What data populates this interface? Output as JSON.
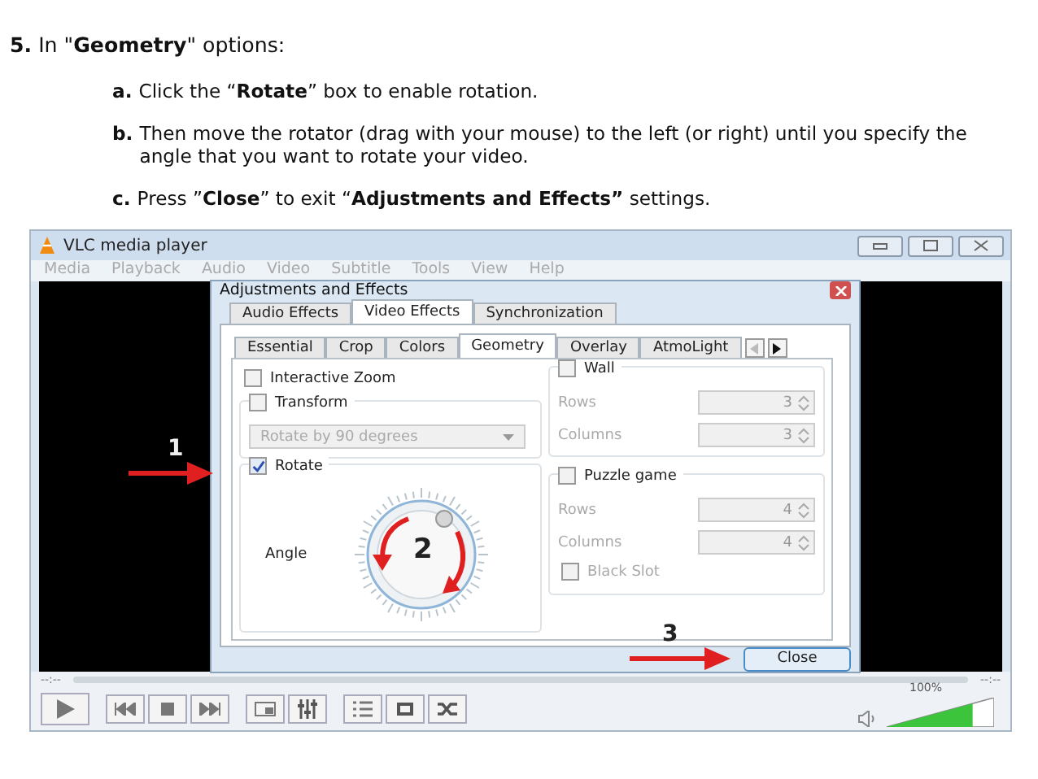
{
  "instructions": {
    "heading": {
      "marker": "5.",
      "text": "In \"**Geometry**\" options:"
    },
    "steps": [
      {
        "marker": "a.",
        "text": "Click the “**Rotate**” box to enable rotation."
      },
      {
        "marker": "b.",
        "text": "Then move the rotator (drag with your mouse) to the left (or right) until you specify the angle that you want to rotate your video."
      },
      {
        "marker": "c.",
        "text": "Press ”**Close**” to exit “**Adjustments and Effects”** settings."
      }
    ]
  },
  "window": {
    "title": "VLC media player"
  },
  "menu": [
    "Media",
    "Playback",
    "Audio",
    "Video",
    "Subtitle",
    "Tools",
    "View",
    "Help"
  ],
  "dialog": {
    "title": "Adjustments and Effects",
    "tabs": [
      {
        "label": "Audio Effects",
        "selected": false
      },
      {
        "label": "Video Effects",
        "selected": true
      },
      {
        "label": "Synchronization",
        "selected": false
      }
    ],
    "subtabs": [
      {
        "label": "Essential",
        "selected": false
      },
      {
        "label": "Crop",
        "selected": false
      },
      {
        "label": "Colors",
        "selected": false
      },
      {
        "label": "Geometry",
        "selected": true
      },
      {
        "label": "Overlay",
        "selected": false
      },
      {
        "label": "AtmoLight",
        "selected": false
      }
    ],
    "interactive_zoom": {
      "label": "Interactive Zoom",
      "checked": false
    },
    "transform": {
      "label": "Transform",
      "checked": false,
      "dropdown": "Rotate by 90 degrees"
    },
    "rotate": {
      "label": "Rotate",
      "checked": true,
      "angle_label": "Angle"
    },
    "wall": {
      "label": "Wall",
      "checked": false,
      "fields": [
        {
          "label": "Rows",
          "value": "3"
        },
        {
          "label": "Columns",
          "value": "3"
        }
      ]
    },
    "puzzle": {
      "label": "Puzzle game",
      "checked": false,
      "fields": [
        {
          "label": "Rows",
          "value": "4"
        },
        {
          "label": "Columns",
          "value": "4"
        }
      ],
      "black_slot": {
        "label": "Black Slot",
        "checked": false
      }
    },
    "close_button": "Close"
  },
  "player": {
    "time_left": "--:--",
    "time_right": "--:--",
    "volume": {
      "level": 0.8,
      "reading": "100%"
    }
  },
  "annotations": [
    "1",
    "2",
    "3"
  ]
}
